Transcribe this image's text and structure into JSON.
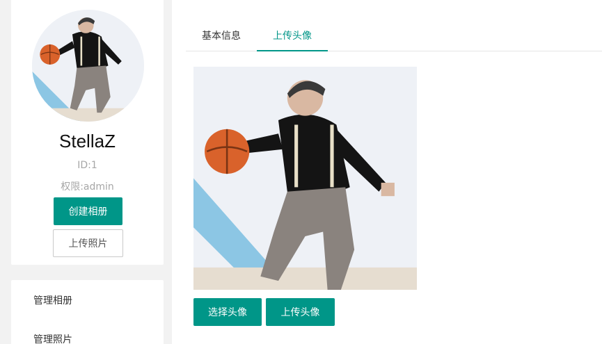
{
  "profile": {
    "username": "StellaZ",
    "id_text": "ID:1",
    "role_text": "权限:admin",
    "create_album_label": "创建相册",
    "upload_photo_label": "上传照片"
  },
  "menu": {
    "items": [
      {
        "label": "管理相册"
      },
      {
        "label": "管理照片"
      }
    ]
  },
  "tabs": [
    {
      "label": "基本信息",
      "active": false
    },
    {
      "label": "上传头像",
      "active": true
    }
  ],
  "avatar_actions": {
    "choose_label": "选择头像",
    "upload_label": "上传头像"
  },
  "colors": {
    "accent": "#009688",
    "page_bg": "#f2f2f2",
    "muted_text": "#a6a6a6"
  }
}
